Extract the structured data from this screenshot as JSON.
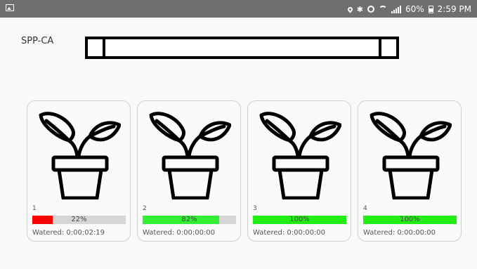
{
  "status_bar": {
    "battery": "60%",
    "time": "2:59 PM"
  },
  "app": {
    "title": "SPP-CA"
  },
  "plants": [
    {
      "number": "1",
      "level_pct": 22,
      "level_text": "22%",
      "watered": "Watered: 0:00:02:19",
      "bar_color": "#ff0000"
    },
    {
      "number": "2",
      "level_pct": 82,
      "level_text": "82%",
      "watered": "Watered: 0:00:00:00",
      "bar_color": "#33ee33"
    },
    {
      "number": "3",
      "level_pct": 100,
      "level_text": "100%",
      "watered": "Watered: 0:00:00:00",
      "bar_color": "#22ee11"
    },
    {
      "number": "4",
      "level_pct": 100,
      "level_text": "100%",
      "watered": "Watered: 0:00:00:00",
      "bar_color": "#22ee11"
    }
  ]
}
